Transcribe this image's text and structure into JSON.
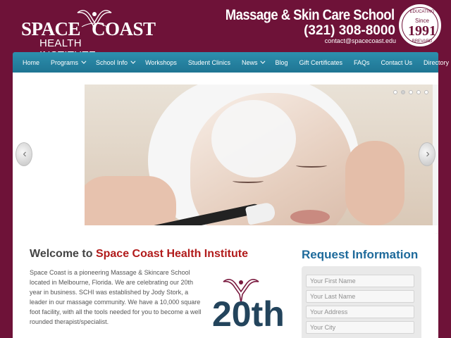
{
  "header": {
    "logo_space": "SPACE",
    "logo_coast": "COAST",
    "logo_sub": "HEALTH INSTITUTE",
    "school_title": "Massage & Skin Care School",
    "phone": "(321) 308-8000",
    "email": "contact@spacecoast.edu",
    "seal": {
      "top": "EDUCATING",
      "since": "Since",
      "year": "1991",
      "bottom": "BREVARD"
    }
  },
  "nav": [
    {
      "label": "Home",
      "caret": false
    },
    {
      "label": "Programs",
      "caret": true
    },
    {
      "label": "School Info",
      "caret": true
    },
    {
      "label": "Workshops",
      "caret": false
    },
    {
      "label": "Student Clinics",
      "caret": false
    },
    {
      "label": "News",
      "caret": true
    },
    {
      "label": "Blog",
      "caret": false
    },
    {
      "label": "Gift Certificates",
      "caret": false
    },
    {
      "label": "FAQs",
      "caret": false
    },
    {
      "label": "Contact Us",
      "caret": false
    },
    {
      "label": "Directory",
      "caret": false
    }
  ],
  "slider": {
    "dots": 5,
    "active_dot": 1,
    "arrow_left": "‹",
    "arrow_right": "›"
  },
  "welcome": {
    "prefix": "Welcome to",
    "name": "Space Coast Health Institute",
    "text": "Space Coast is a pioneering Massage & Skincare School located in Melbourne, Florida. We are celebrating our 20th year in business. SCHI was established by Jody Stork, a leader in our massage community. We have a 10,000 square foot facility, with all the tools needed for you to become a well rounded therapist/specialist.",
    "badge": "20th"
  },
  "request": {
    "title": "Request Information",
    "fields": [
      {
        "placeholder": "Your First Name"
      },
      {
        "placeholder": "Your Last Name"
      },
      {
        "placeholder": "Your Address"
      },
      {
        "placeholder": "Your City"
      }
    ]
  },
  "colors": {
    "brand": "#6e1238",
    "nav": "#2484a3",
    "accent_red": "#b11b1b",
    "accent_blue": "#1e6a9b"
  }
}
